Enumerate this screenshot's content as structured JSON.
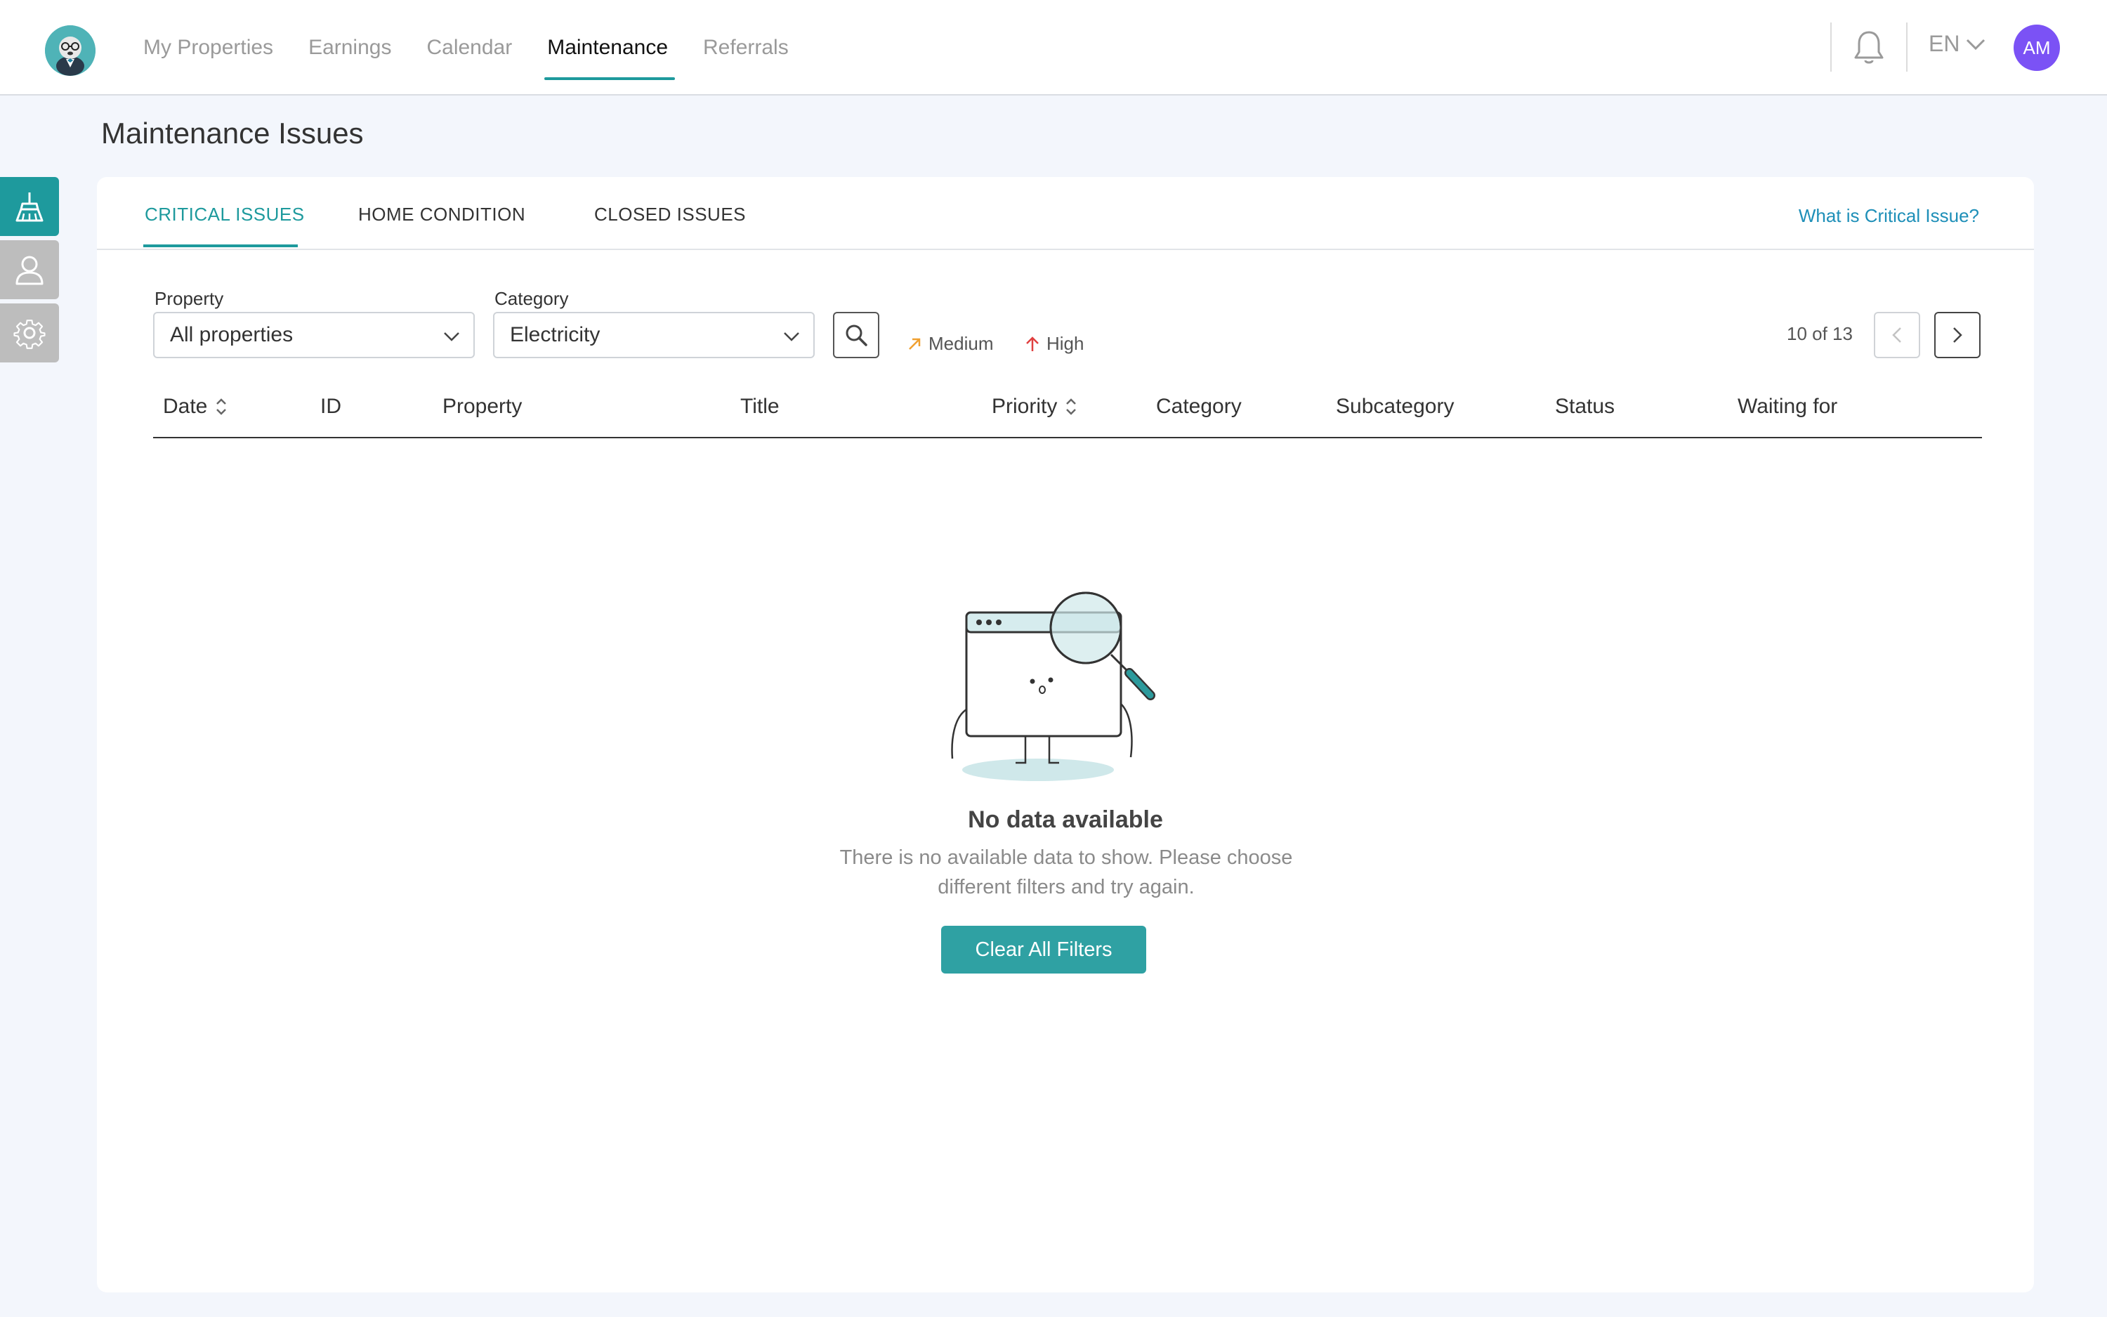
{
  "header": {
    "nav": [
      {
        "label": "My Properties"
      },
      {
        "label": "Earnings"
      },
      {
        "label": "Calendar"
      },
      {
        "label": "Maintenance",
        "active": true
      },
      {
        "label": "Referrals"
      }
    ],
    "language": "EN",
    "avatar_initials": "AM",
    "avatar_color": "#7b52f5"
  },
  "sidebar": {
    "items": [
      {
        "icon": "broom-icon",
        "active": true
      },
      {
        "icon": "user-icon"
      },
      {
        "icon": "gear-icon"
      }
    ]
  },
  "page": {
    "title": "Maintenance Issues"
  },
  "tabs": [
    {
      "label": "CRITICAL ISSUES",
      "active": true
    },
    {
      "label": "HOME CONDITION"
    },
    {
      "label": "CLOSED ISSUES"
    }
  ],
  "help_link": "What is Critical Issue?",
  "filters": {
    "property_label": "Property",
    "property_value": "All properties",
    "category_label": "Category",
    "category_value": "Electricity"
  },
  "legend": {
    "medium": "Medium",
    "high": "High",
    "medium_color": "#f0a030",
    "high_color": "#e04040"
  },
  "pagination": {
    "text": "10 of 13"
  },
  "table": {
    "columns": [
      "Date",
      "ID",
      "Property",
      "Title",
      "Priority",
      "Category",
      "Subcategory",
      "Status",
      "Waiting for"
    ]
  },
  "empty_state": {
    "title": "No data available",
    "description": "There is no available data to show. Please choose different filters and try again.",
    "button": "Clear All Filters"
  },
  "colors": {
    "accent": "#1e9a9d",
    "link": "#1e8fb8"
  }
}
